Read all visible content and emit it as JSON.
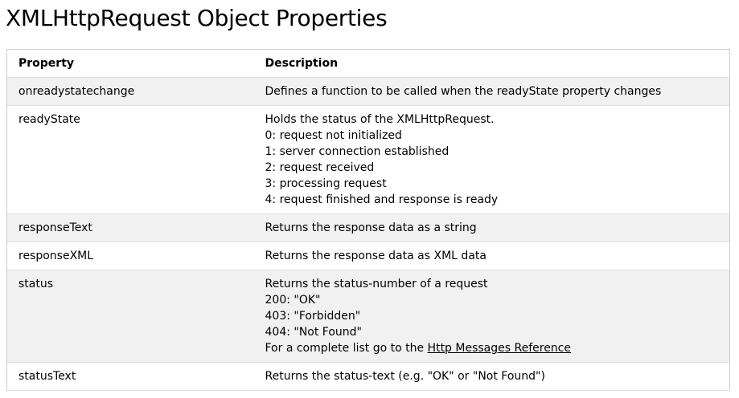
{
  "page": {
    "title": "XMLHttpRequest Object Properties"
  },
  "table": {
    "headers": {
      "property": "Property",
      "description": "Description"
    },
    "rows": [
      {
        "property": "onreadystatechange",
        "lines": [
          "Defines a function to be called when the readyState property changes"
        ]
      },
      {
        "property": "readyState",
        "lines": [
          "Holds the status of the XMLHttpRequest.",
          "0: request not initialized",
          "1: server connection established",
          "2: request received",
          "3: processing request",
          "4: request finished and response is ready"
        ]
      },
      {
        "property": "responseText",
        "lines": [
          "Returns the response data as a string"
        ]
      },
      {
        "property": "responseXML",
        "lines": [
          "Returns the response data as XML data"
        ]
      },
      {
        "property": "status",
        "lines": [
          "Returns the status-number of a request",
          "200: \"OK\"",
          "403: \"Forbidden\"",
          "404: \"Not Found\""
        ],
        "link_prefix": "For a complete list go to the ",
        "link_text": "Http Messages Reference"
      },
      {
        "property": "statusText",
        "lines": [
          "Returns the status-text (e.g. \"OK\" or \"Not Found\")"
        ]
      }
    ]
  }
}
